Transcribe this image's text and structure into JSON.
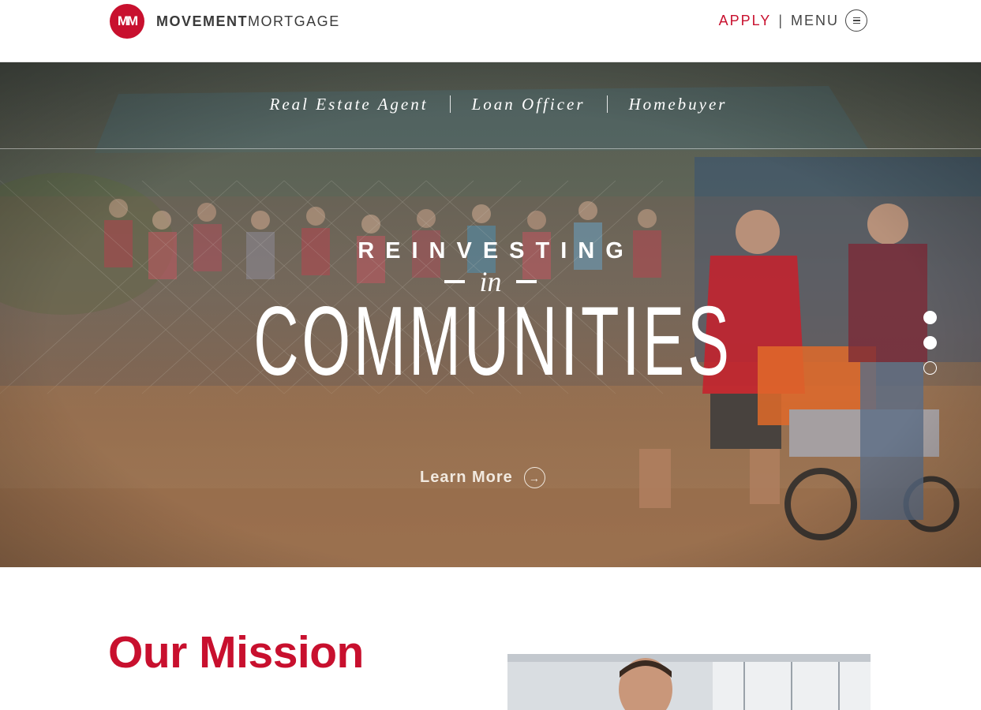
{
  "header": {
    "logo_mark": "MM",
    "logo_word_bold": "MOVEMENT",
    "logo_word_light": "MORTGAGE",
    "apply_label": "APPLY",
    "separator": "|",
    "menu_label": "MENU"
  },
  "hero": {
    "audience_tabs": [
      {
        "label": "Real Estate Agent"
      },
      {
        "label": "Loan Officer"
      },
      {
        "label": "Homebuyer"
      }
    ],
    "headline_top": "REINVESTING",
    "headline_mid": "in",
    "headline_main": "COMMUNITIES",
    "cta_label": "Learn More",
    "slides": [
      {
        "state": "filled"
      },
      {
        "state": "filled"
      },
      {
        "state": "empty"
      }
    ]
  },
  "mission": {
    "title": "Our Mission"
  },
  "colors": {
    "brand_red": "#c8102e",
    "text_dark": "#3a3a3a",
    "white": "#ffffff"
  },
  "icons": {
    "logo": "mm-logo-icon",
    "menu": "hamburger-icon",
    "cta": "arrow-right-circle-icon"
  }
}
